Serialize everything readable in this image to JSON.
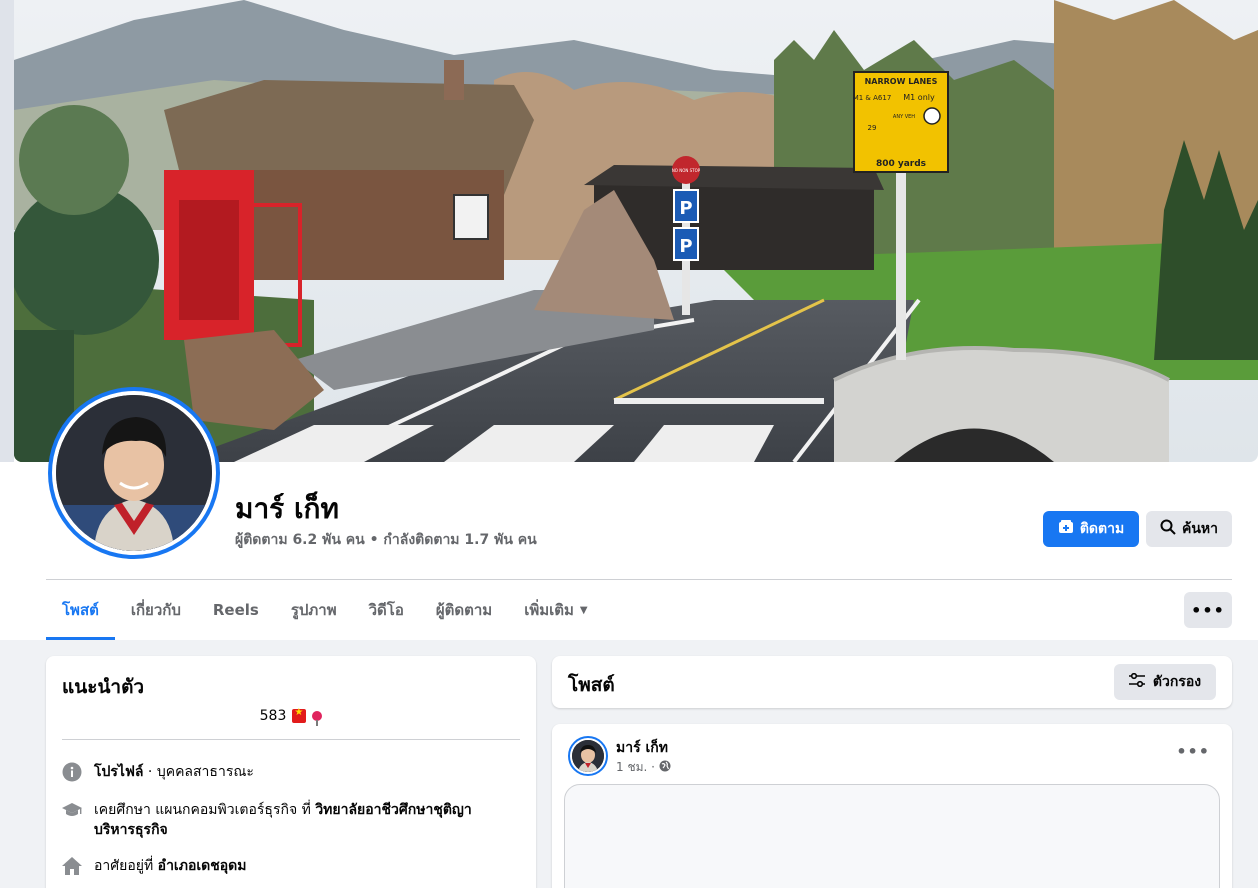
{
  "profile": {
    "name": "มาร์ เก็ท",
    "stats": "ผู้ติดตาม 6.2 พัน คน • กำลังติดตาม 1.7 พัน คน"
  },
  "actions": {
    "follow": "ติดตาม",
    "search": "ค้นหา",
    "more": "•••"
  },
  "tabs": [
    {
      "label": "โพสต์",
      "active": true
    },
    {
      "label": "เกี่ยวกับ"
    },
    {
      "label": "Reels"
    },
    {
      "label": "รูปภาพ"
    },
    {
      "label": "วิดีโอ"
    },
    {
      "label": "ผู้ติดตาม"
    },
    {
      "label": "เพิ่มเติม"
    }
  ],
  "intro": {
    "title": "แนะนำตัว",
    "bio": "583",
    "rows": [
      {
        "icon": "info-icon",
        "label": "โปรไฟล์",
        "text": " · บุคคลสาธารณะ"
      },
      {
        "icon": "graduation-cap-icon",
        "prefix": "เคยศึกษา แผนกคอมพิวเตอร์ธุรกิจ ที่ ",
        "place": "วิทยาลัยอาชีวศึกษาชุติญา บริหารธุรกิจ"
      },
      {
        "icon": "home-icon",
        "prefix": "อาศัยอยู่ที่ ",
        "place": "อำเภอเดชอุดม"
      }
    ]
  },
  "posts": {
    "title": "โพสต์",
    "filter": "ตัวกรอง",
    "items": [
      {
        "author": "มาร์ เก็ท",
        "time": "1 ชม. ·"
      }
    ]
  },
  "cover_sign": {
    "title": "NARROW LANES",
    "left": "M1 & A617",
    "badge": "29",
    "right": "M1 only",
    "vehicles": "ANY VEH",
    "distance": "800 yards",
    "nonstop": "NO NON STOP"
  },
  "colors": {
    "accent": "#1877f2",
    "bg": "#f0f2f5",
    "muted_text": "#65676b"
  }
}
